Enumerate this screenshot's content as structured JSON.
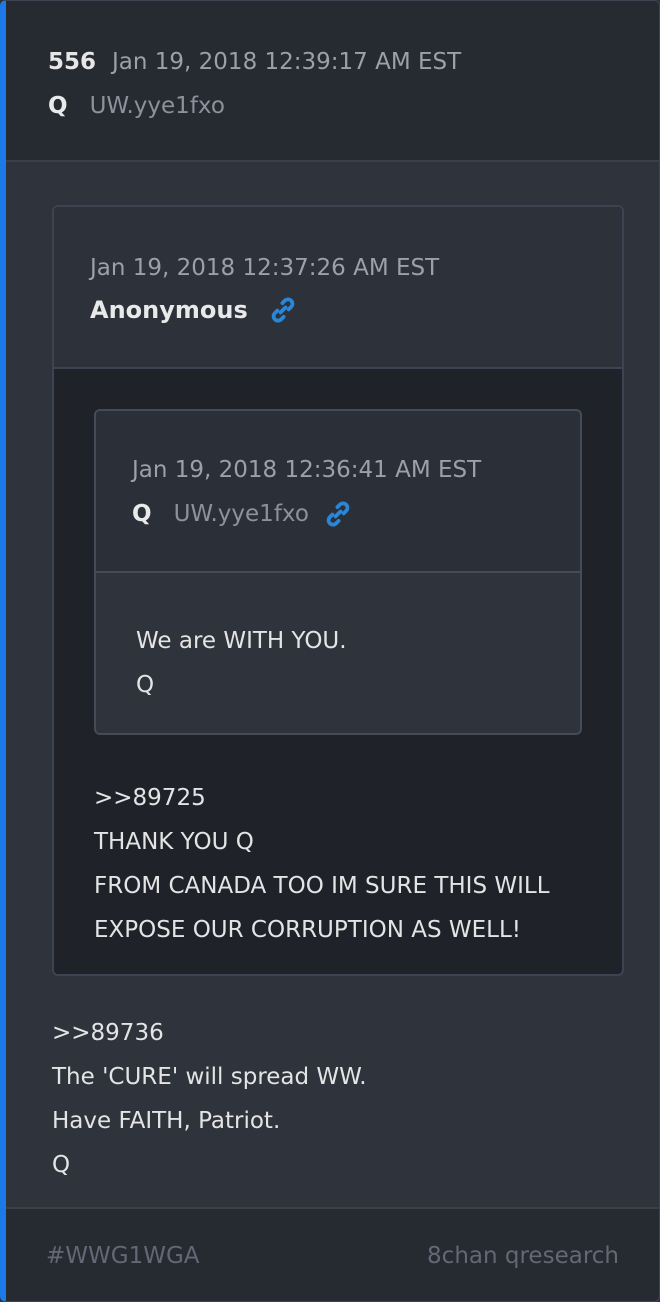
{
  "post": {
    "number": "556",
    "date": "Jan 19, 2018 12:39:17 AM EST",
    "author": "Q",
    "tripcode": "!UW.yye1fxo",
    "tripcode_display": "UW.yye1fxo"
  },
  "quote_anon": {
    "date": "Jan 19, 2018 12:37:26 AM EST",
    "author": "Anonymous",
    "icon": "link-icon",
    "body": [
      ">>89725",
      "THANK YOU Q",
      "FROM CANADA TOO IM SURE THIS WILL",
      "EXPOSE OUR CORRUPTION AS WELL!"
    ]
  },
  "quote_q": {
    "date": "Jan 19, 2018 12:36:41 AM EST",
    "author": "Q",
    "tripcode": "UW.yye1fxo",
    "icon": "link-icon",
    "body": [
      "We are WITH YOU.",
      "Q"
    ]
  },
  "body": [
    ">>89736",
    "The 'CURE' will spread WW.",
    "Have FAITH, Patriot.",
    "Q"
  ],
  "footer": {
    "tag": "#WWG1WGA",
    "source": "8chan qresearch"
  },
  "colors": {
    "accent": "#1c79e6",
    "link_icon": "#2a86d6"
  }
}
